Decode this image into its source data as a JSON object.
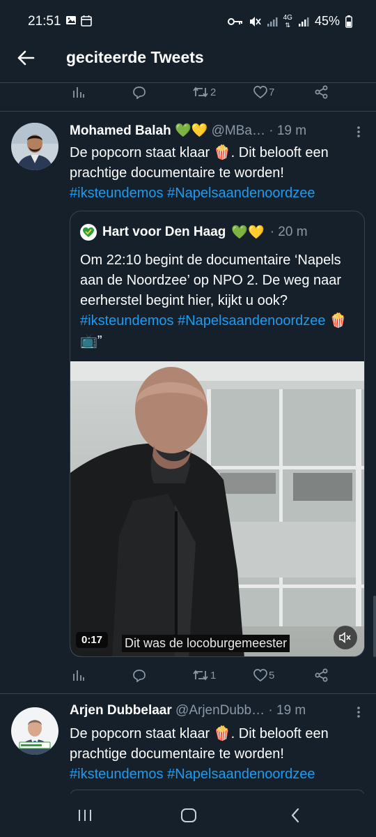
{
  "status_bar": {
    "time": "21:51",
    "network": "4G",
    "battery": "45%"
  },
  "header": {
    "title": "geciteerde Tweets",
    "back_icon": "arrow-left-icon"
  },
  "top_actions": {
    "retweets": "2",
    "likes": "7"
  },
  "tweets": [
    {
      "name": "Mohamed Balah",
      "emoji": "💚💛",
      "handle": "@MBa…",
      "time": "· 19 m",
      "text_plain": "De popcorn staat klaar 🍿. Dit belooft een prachtige documentaire te worden!",
      "hashtags": "#iksteundemos #Napelsaandenoordzee",
      "quote": {
        "name": "Hart voor Den Haag",
        "emoji": "💚💛",
        "time": "· 20 m",
        "text_plain": "Om 22:10 begint de documentaire ‘Napels aan de Noordzee’ op NPO 2. De weg naar eerherstel begint hier, kijkt u ook?",
        "hashtag1": "#iksteundemos",
        "hashtag2": "#Napelsaandenoordzee",
        "text_end": "🍿📺”",
        "video": {
          "duration": "0:17",
          "caption": "Dit was de locoburgemeester"
        }
      },
      "actions": {
        "retweets": "1",
        "likes": "5"
      }
    },
    {
      "name": "Arjen Dubbelaar",
      "handle": "@ArjenDubb…",
      "time": "· 19 m",
      "text_plain": "De popcorn staat klaar 🍿. Dit belooft een prachtige documentaire te worden!",
      "hashtags": "#iksteundemos #Napelsaandenoordzee"
    }
  ],
  "colors": {
    "background": "#15202b",
    "link": "#1d9bf0",
    "muted": "#8b98a5",
    "divider": "#38444d"
  }
}
